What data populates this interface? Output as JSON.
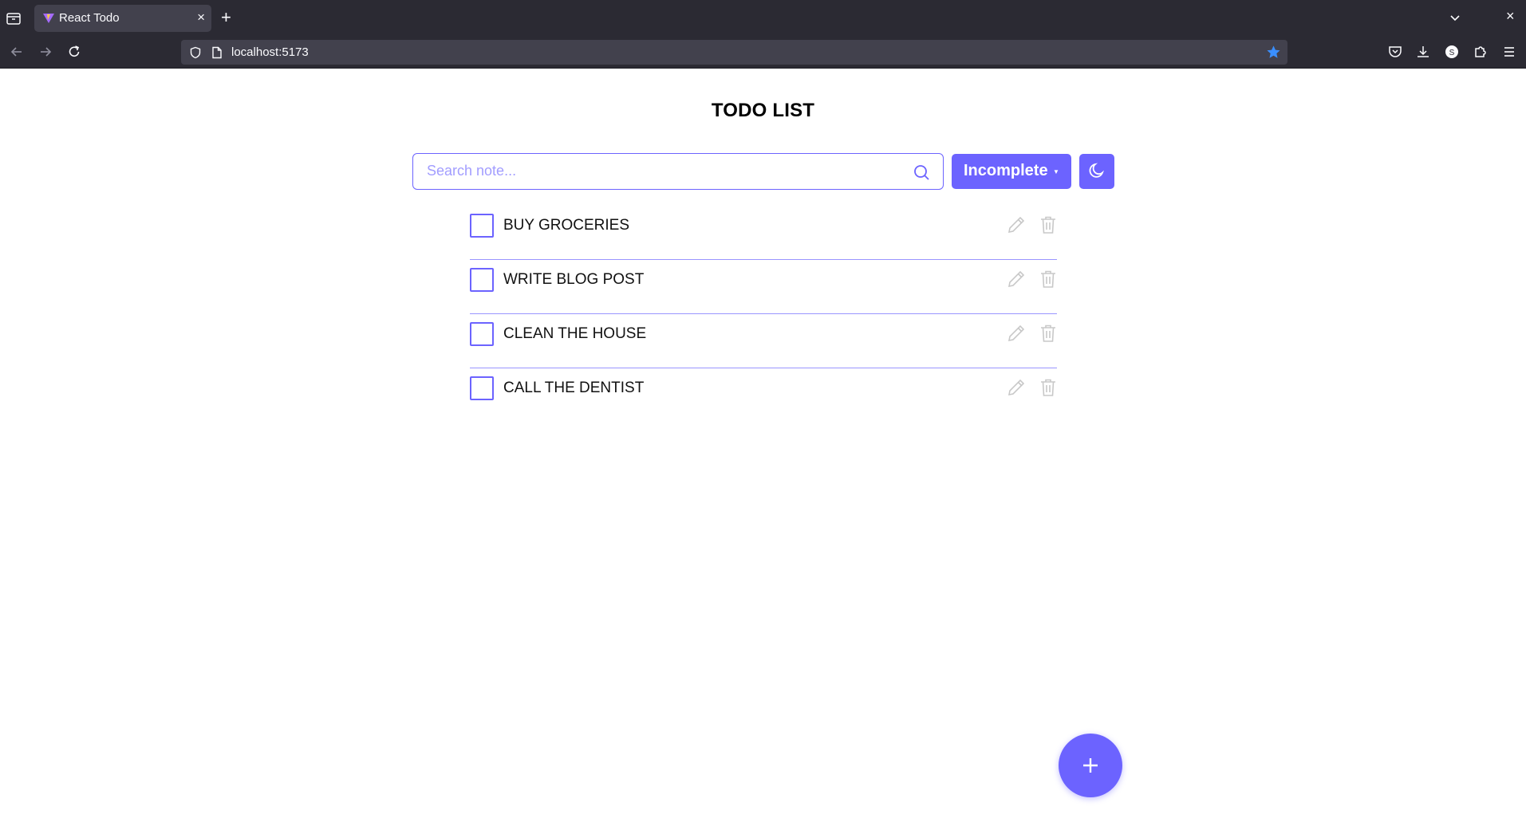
{
  "browser": {
    "tab_title": "React Todo",
    "tab_close": "×",
    "new_tab": "+",
    "window_close": "×",
    "url": "localhost:5173"
  },
  "app": {
    "title": "TODO LIST",
    "search": {
      "placeholder": "Search note..."
    },
    "filter": {
      "selected": "Incomplete"
    },
    "todos": [
      {
        "label": "BUY GROCERIES",
        "done": false
      },
      {
        "label": "WRITE BLOG POST",
        "done": false
      },
      {
        "label": "CLEAN THE HOUSE",
        "done": false
      },
      {
        "label": "CALL THE DENTIST",
        "done": false
      }
    ]
  },
  "colors": {
    "accent": "#6c63ff",
    "chrome_bg": "#2b2a33",
    "urlbar_bg": "#42414d"
  },
  "icons": [
    "search-icon",
    "moon-icon",
    "edit-icon",
    "trash-icon",
    "plus-icon"
  ]
}
